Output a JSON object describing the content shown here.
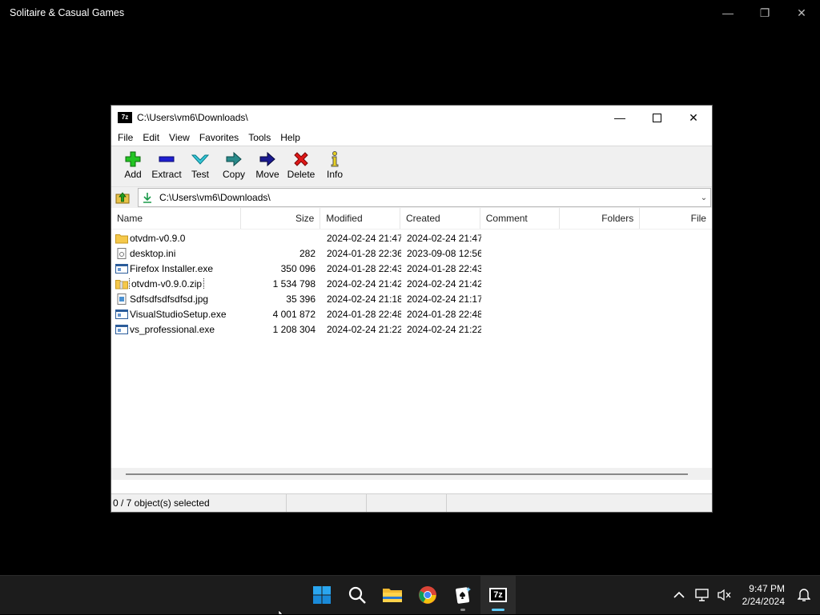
{
  "background_app": {
    "title": "Solitaire & Casual Games"
  },
  "window": {
    "title": "C:\\Users\\vm6\\Downloads\\",
    "icon_text": "7z",
    "menu": [
      "File",
      "Edit",
      "View",
      "Favorites",
      "Tools",
      "Help"
    ],
    "toolbar": [
      {
        "label": "Add",
        "icon": "add-icon"
      },
      {
        "label": "Extract",
        "icon": "extract-icon"
      },
      {
        "label": "Test",
        "icon": "test-icon"
      },
      {
        "label": "Copy",
        "icon": "copy-icon"
      },
      {
        "label": "Move",
        "icon": "move-icon"
      },
      {
        "label": "Delete",
        "icon": "delete-icon"
      },
      {
        "label": "Info",
        "icon": "info-icon"
      }
    ],
    "address": "C:\\Users\\vm6\\Downloads\\",
    "columns": [
      "Name",
      "Size",
      "Modified",
      "Created",
      "Comment",
      "Folders",
      "File"
    ],
    "files": [
      {
        "name": "otvdm-v0.9.0",
        "size": "",
        "modified": "2024-02-24 21:47",
        "created": "2024-02-24 21:47",
        "type": "folder"
      },
      {
        "name": "desktop.ini",
        "size": "282",
        "modified": "2024-01-28 22:36",
        "created": "2023-09-08 12:56",
        "type": "ini"
      },
      {
        "name": "Firefox Installer.exe",
        "size": "350 096",
        "modified": "2024-01-28 22:43",
        "created": "2024-01-28 22:43",
        "type": "exe"
      },
      {
        "name": "otvdm-v0.9.0.zip",
        "size": "1 534 798",
        "modified": "2024-02-24 21:42",
        "created": "2024-02-24 21:42",
        "type": "zip"
      },
      {
        "name": "Sdfsdfsdfsdfsd.jpg",
        "size": "35 396",
        "modified": "2024-02-24 21:18",
        "created": "2024-02-24 21:17",
        "type": "jpg"
      },
      {
        "name": "VisualStudioSetup.exe",
        "size": "4 001 872",
        "modified": "2024-01-28 22:48",
        "created": "2024-01-28 22:48",
        "type": "exe"
      },
      {
        "name": "vs_professional.exe",
        "size": "1 208 304",
        "modified": "2024-02-24 21:22",
        "created": "2024-02-24 21:22",
        "type": "exe"
      }
    ],
    "status": "0 / 7 object(s) selected"
  },
  "taskbar": {
    "apps": [
      "start-icon",
      "search-icon",
      "file-explorer-icon",
      "chrome-icon",
      "solitaire-icon",
      "7zip-icon"
    ],
    "time": "9:47 PM",
    "date": "2/24/2024",
    "accent": "#60cdff"
  }
}
